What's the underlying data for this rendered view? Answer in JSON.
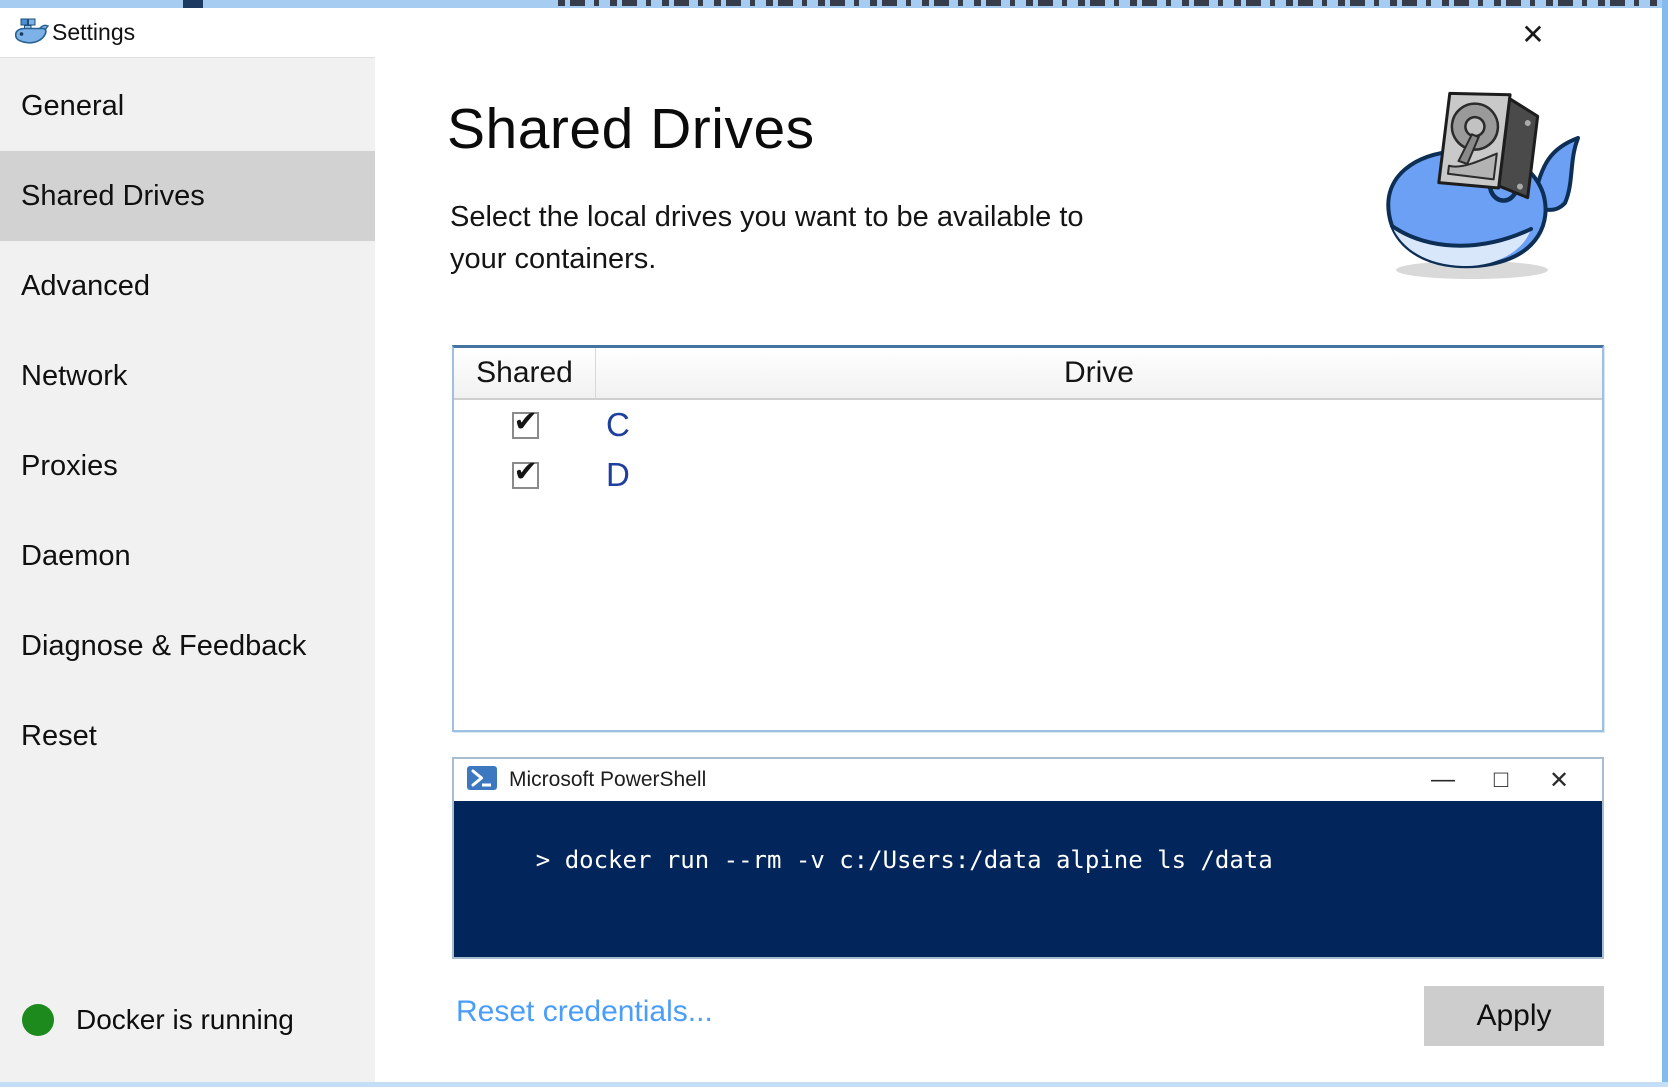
{
  "window": {
    "title": "Settings",
    "close_icon": "✕"
  },
  "sidebar": {
    "items": [
      {
        "label": "General",
        "selected": false
      },
      {
        "label": "Shared Drives",
        "selected": true
      },
      {
        "label": "Advanced",
        "selected": false
      },
      {
        "label": "Network",
        "selected": false
      },
      {
        "label": "Proxies",
        "selected": false
      },
      {
        "label": "Daemon",
        "selected": false
      },
      {
        "label": "Diagnose & Feedback",
        "selected": false
      },
      {
        "label": "Reset",
        "selected": false
      }
    ],
    "status": {
      "label": "Docker is running",
      "state": "running"
    }
  },
  "main": {
    "title": "Shared Drives",
    "subtitle": "Select the local drives you want to be available to your containers.",
    "drives_table": {
      "columns": [
        "Shared",
        "Drive"
      ],
      "rows": [
        {
          "shared": true,
          "drive": "C"
        },
        {
          "shared": true,
          "drive": "D"
        }
      ]
    },
    "powershell": {
      "window_title": "Microsoft PowerShell",
      "minimize_icon": "—",
      "maximize_icon": "□",
      "close_icon": "✕",
      "command": "> docker run --rm -v c:/Users:/data alpine ls /data"
    },
    "reset_credentials_label": "Reset credentials...",
    "apply_label": "Apply"
  },
  "icons": {
    "checkbox_check": "✔"
  },
  "colors": {
    "accent_border_blue": "#44749f",
    "table_border_blue": "#9dc1e2",
    "terminal_bg": "#02255b",
    "status_green": "#1c8a1c",
    "link_blue": "#4a9df8",
    "drive_letter_blue": "#1f3f9e",
    "selected_item_bg": "#d2d2d2"
  }
}
